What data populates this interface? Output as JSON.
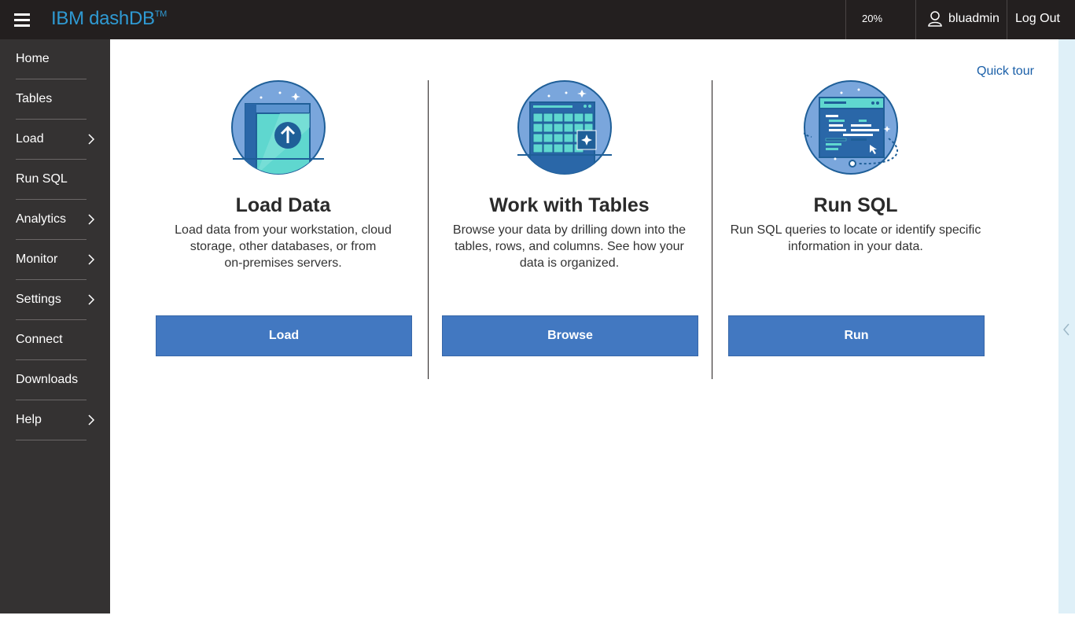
{
  "header": {
    "brand": "IBM dashDB",
    "trademark": "TM",
    "zoom": "20%",
    "username": "bluadmin",
    "logout_label": "Log Out"
  },
  "sidebar": {
    "items": [
      {
        "label": "Home",
        "has_submenu": false
      },
      {
        "label": "Tables",
        "has_submenu": false
      },
      {
        "label": "Load",
        "has_submenu": true
      },
      {
        "label": "Run SQL",
        "has_submenu": false
      },
      {
        "label": "Analytics",
        "has_submenu": true
      },
      {
        "label": "Monitor",
        "has_submenu": true
      },
      {
        "label": "Settings",
        "has_submenu": true
      },
      {
        "label": "Connect",
        "has_submenu": false
      },
      {
        "label": "Downloads",
        "has_submenu": false
      },
      {
        "label": "Help",
        "has_submenu": true
      }
    ]
  },
  "main": {
    "quick_tour": "Quick tour",
    "cards": [
      {
        "icon": "load-data-icon",
        "title": "Load Data",
        "desc_lines": [
          "Load data from your workstation, cloud",
          "storage, other databases, or from",
          "on-premises servers."
        ],
        "button": "Load"
      },
      {
        "icon": "tables-grid-icon",
        "title": "Work with Tables",
        "desc_lines": [
          "Browse your data by drilling down into the",
          "tables, rows, and columns. See how your",
          "data is organized."
        ],
        "button": "Browse"
      },
      {
        "icon": "sql-editor-icon",
        "title": "Run SQL",
        "desc_lines": [
          "Run SQL queries to locate or identify specific",
          "information in your data."
        ],
        "button": "Run"
      }
    ]
  },
  "colors": {
    "topbar": "#231f1f",
    "sidebar": "#343232",
    "brand": "#2f9ad3",
    "button": "#4278c1",
    "link": "#1a5fa8",
    "rail": "#dff0f8"
  }
}
